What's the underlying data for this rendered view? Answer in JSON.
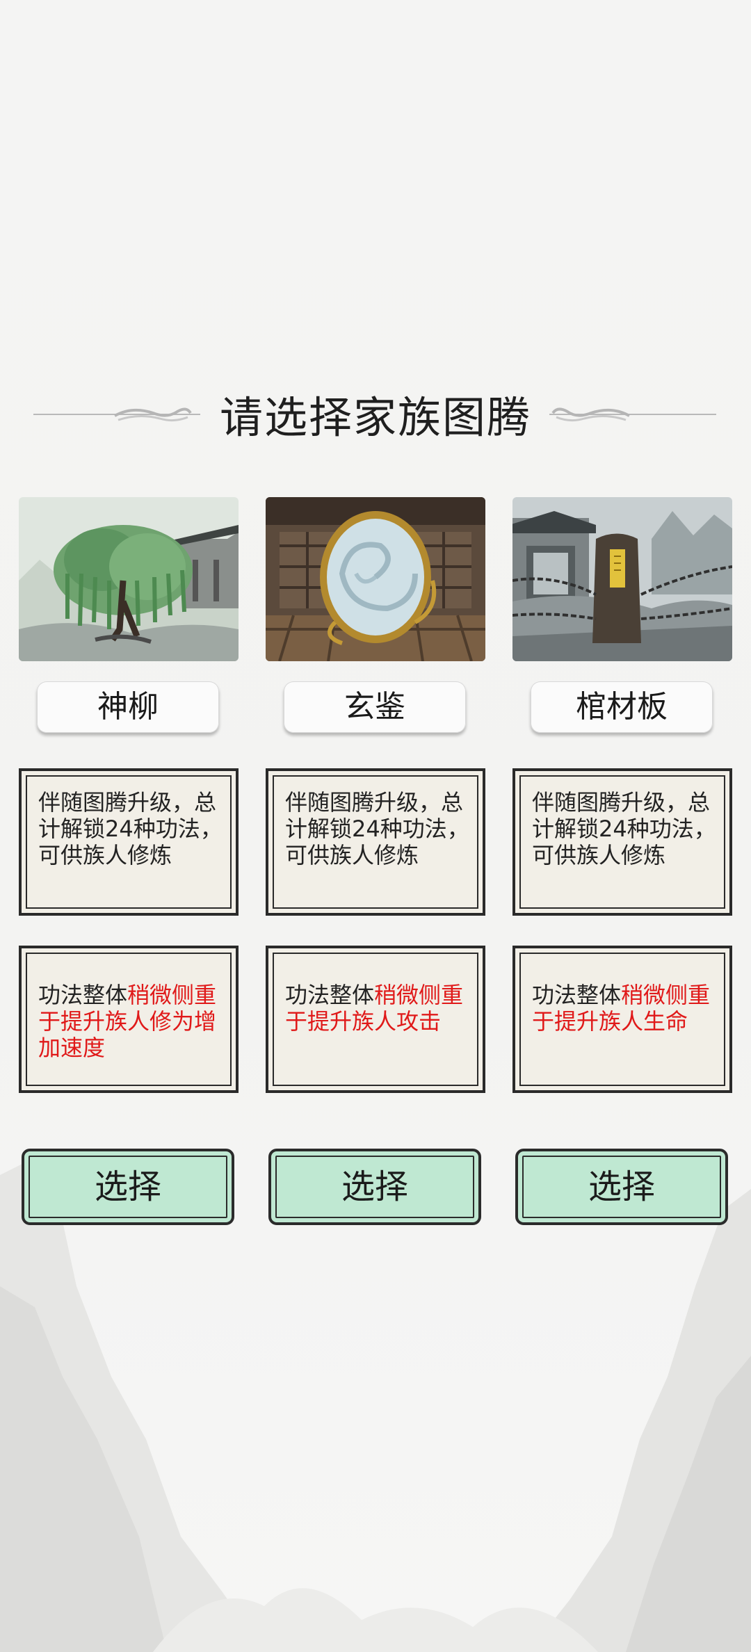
{
  "title": "请选择家族图腾",
  "totems": [
    {
      "name": "神柳",
      "desc1": "伴随图腾升级，总计解锁24种功法，可供族人修炼",
      "desc2_prefix": "功法整体",
      "desc2_highlight": "稍微侧重于提升族人修为增加速度",
      "select_label": "选择",
      "image": "willow-tree-scene"
    },
    {
      "name": "玄鉴",
      "desc1": "伴随图腾升级，总计解锁24种功法，可供族人修炼",
      "desc2_prefix": "功法整体",
      "desc2_highlight": "稍微侧重于提升族人攻击",
      "select_label": "选择",
      "image": "mystic-mirror-scene"
    },
    {
      "name": "棺材板",
      "desc1": "伴随图腾升级，总计解锁24种功法，可供族人修炼",
      "desc2_prefix": "功法整体",
      "desc2_highlight": "稍微侧重于提升族人生命",
      "select_label": "选择",
      "image": "chained-coffin-lid-scene"
    }
  ],
  "colors": {
    "highlight": "#e01919",
    "select_button": "#bfe8d2"
  }
}
